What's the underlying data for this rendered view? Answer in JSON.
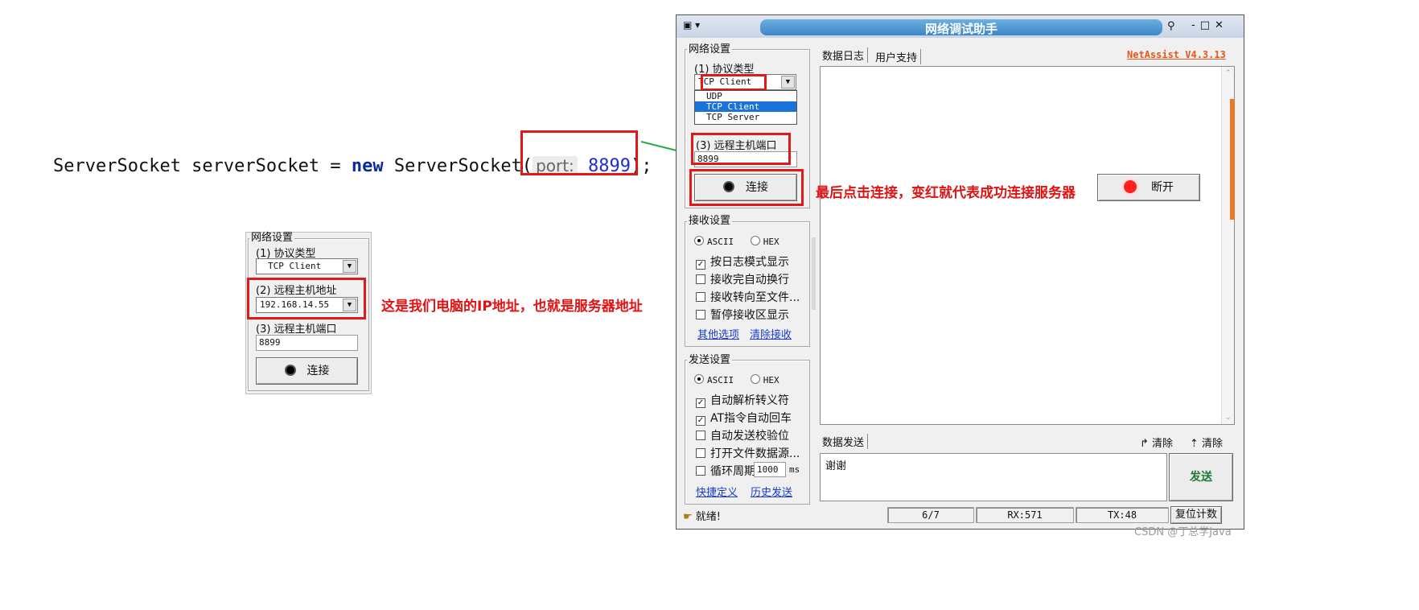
{
  "code": {
    "text_before": "ServerSocket serverSocket = ",
    "keyword": "new",
    "text_mid": " ServerSocket(",
    "hint": "port:",
    "value": "8899",
    "text_after": ");"
  },
  "small_panel": {
    "group_label": "网络设置",
    "protocol_label": "(1) 协议类型",
    "protocol_value": "TCP Client",
    "host_label": "(2) 远程主机地址",
    "host_value": "192.168.14.55",
    "port_label": "(3) 远程主机端口",
    "port_value": "8899",
    "connect_label": "连接"
  },
  "annotations": {
    "ip_note": "这是我们电脑的IP地址，也就是服务器地址",
    "connect_note": "最后点击连接，变红就代表成功连接服务器"
  },
  "disconnect_button": {
    "label": "断开"
  },
  "window": {
    "title": "网络调试助手",
    "version": "NetAssist V4.3.13",
    "network": {
      "group_label": "网络设置",
      "protocol_label": "(1) 协议类型",
      "protocol_value": "TCP Client",
      "protocol_options": [
        "UDP",
        "TCP Client",
        "TCP Server"
      ],
      "port_label": "(3) 远程主机端口",
      "port_value": "8899",
      "connect_label": "连接"
    },
    "receive": {
      "group_label": "接收设置",
      "ascii": "ASCII",
      "hex": "HEX",
      "options": [
        {
          "label": "按日志模式显示",
          "checked": true
        },
        {
          "label": "接收完自动换行",
          "checked": false
        },
        {
          "label": "接收转向至文件...",
          "checked": false
        },
        {
          "label": "暂停接收区显示",
          "checked": false
        }
      ],
      "link_more": "其他选项",
      "link_clear": "清除接收"
    },
    "send": {
      "group_label": "发送设置",
      "ascii": "ASCII",
      "hex": "HEX",
      "options": [
        {
          "label": "自动解析转义符",
          "checked": true
        },
        {
          "label": "AT指令自动回车",
          "checked": true
        },
        {
          "label": "自动发送校验位",
          "checked": false
        },
        {
          "label": "打开文件数据源...",
          "checked": false
        }
      ],
      "loop_label": "循环周期",
      "loop_value": "1000",
      "loop_unit": "ms",
      "link_shortcut": "快捷定义",
      "link_history": "历史发送"
    },
    "tabs": [
      "数据日志",
      "用户支持"
    ],
    "send_area": {
      "tab": "数据发送",
      "clear1": "清除",
      "clear2": "清除",
      "text": "谢谢",
      "send_button": "发送"
    },
    "status": {
      "ready": "就绪!",
      "count": "6/7",
      "rx": "RX:571",
      "tx": "TX:48",
      "reset": "复位计数"
    }
  },
  "watermark": "CSDN @丁总学Java"
}
